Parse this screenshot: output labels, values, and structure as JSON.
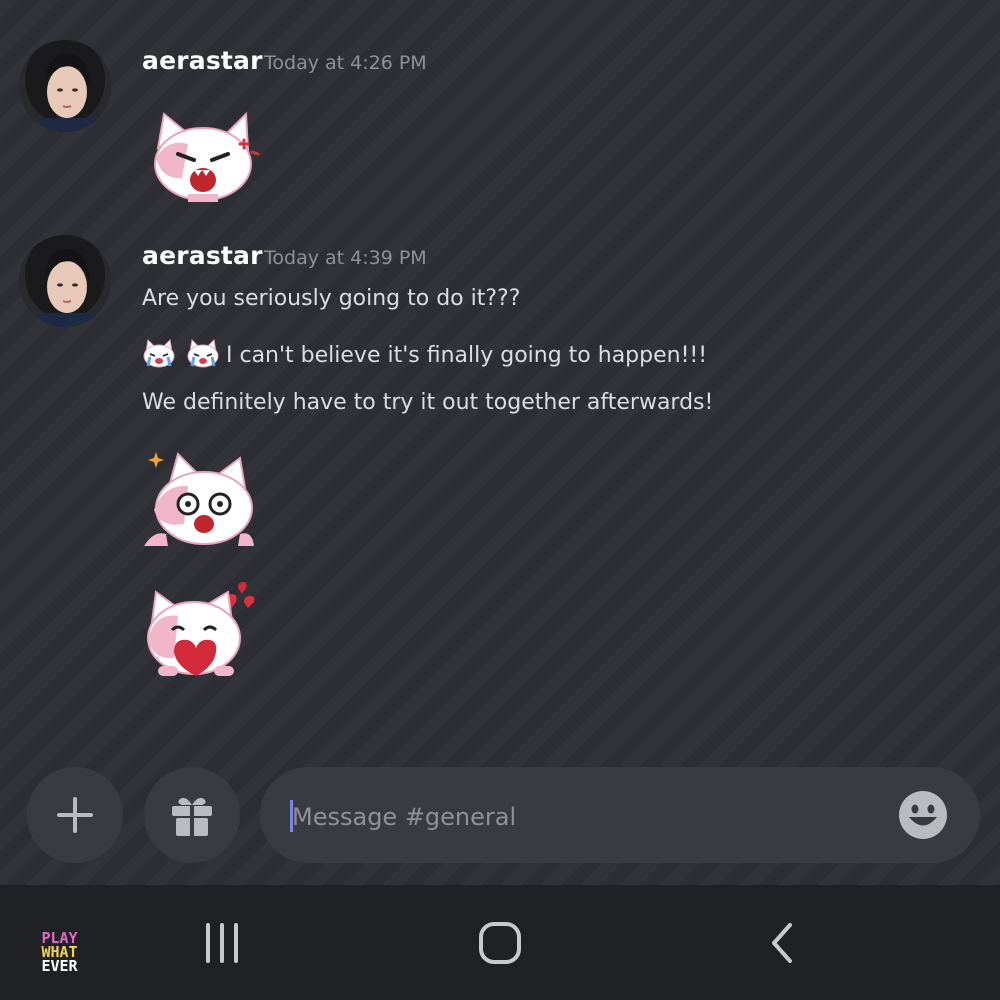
{
  "messages": [
    {
      "username": "aerastar",
      "timestamp": "Today at 4:26 PM",
      "sticker": "angry-cat-sticker"
    },
    {
      "username": "aerastar",
      "timestamp": "Today at 4:39 PM",
      "lines": [
        "Are you seriously going to do it???",
        "I can't believe it's finally going to happen!!!",
        "We definitely have to try it out together afterwards!"
      ],
      "inline_emojis": [
        "crying-cat-emoji",
        "crying-cat-emoji"
      ],
      "stickers": [
        "excited-cat-sticker",
        "heart-cat-sticker"
      ]
    }
  ],
  "composer": {
    "placeholder": "Message #general",
    "add_icon": "plus-icon",
    "gift_icon": "gift-icon",
    "emoji_icon": "smile-icon"
  },
  "navbar": {
    "logo": [
      "PLAY",
      "WHAT",
      "EVER"
    ],
    "recent_icon": "recent-apps-icon",
    "home_icon": "home-icon",
    "back_icon": "back-icon"
  },
  "colors": {
    "chat_bg": "#2e2f35",
    "input_bg": "#3a3b41",
    "navbar_bg": "#202125",
    "caret": "#7e86e6"
  }
}
